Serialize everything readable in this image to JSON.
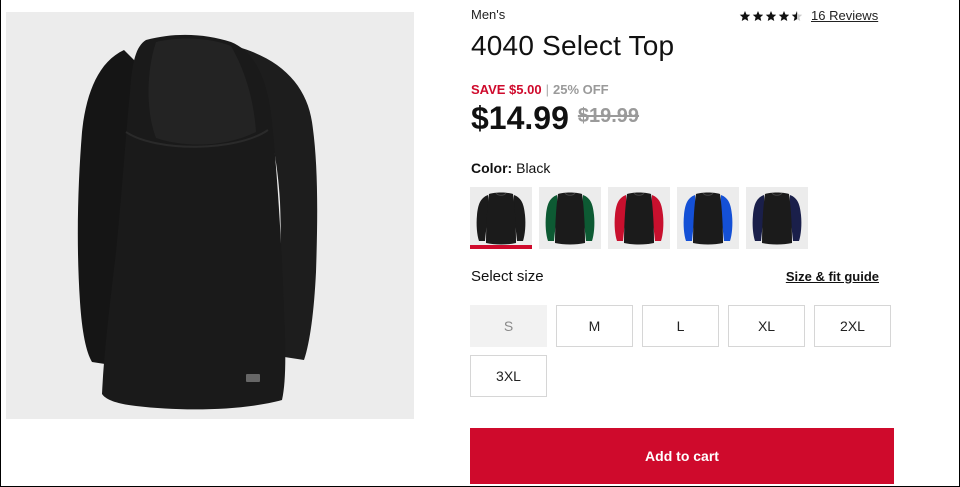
{
  "product": {
    "category": "Men's",
    "title": "4040 Select Top",
    "rating": {
      "stars": 4.5,
      "max_stars": 5,
      "reviews_label": "16 Reviews"
    },
    "pricing": {
      "save_text": "SAVE $5.00",
      "separator": "|",
      "percent_off": "25% OFF",
      "sale_price": "$14.99",
      "original_price": "$19.99"
    },
    "color": {
      "label": "Color:",
      "selected_name": "Black"
    },
    "swatches": [
      {
        "name": "Black",
        "body_color": "#1b1b1b",
        "sleeve_color": "#1b1b1b",
        "selected": true
      },
      {
        "name": "Green",
        "body_color": "#1b1b1b",
        "sleeve_color": "#0d5a33",
        "selected": false
      },
      {
        "name": "Red",
        "body_color": "#1b1b1b",
        "sleeve_color": "#c8102e",
        "selected": false
      },
      {
        "name": "Royal",
        "body_color": "#1b1b1b",
        "sleeve_color": "#1450d6",
        "selected": false
      },
      {
        "name": "Navy",
        "body_color": "#1b1b1b",
        "sleeve_color": "#1a1f4a",
        "selected": false
      }
    ],
    "size": {
      "label": "Select size",
      "guide_label": "Size & fit guide",
      "options": [
        {
          "label": "S",
          "available": false
        },
        {
          "label": "M",
          "available": true
        },
        {
          "label": "L",
          "available": true
        },
        {
          "label": "XL",
          "available": true
        },
        {
          "label": "2XL",
          "available": true
        },
        {
          "label": "3XL",
          "available": true
        }
      ]
    },
    "add_to_cart_label": "Add to cart"
  },
  "colors": {
    "accent": "#cf0a2c",
    "muted": "#9a9a9a",
    "image_bg": "#ececec"
  }
}
